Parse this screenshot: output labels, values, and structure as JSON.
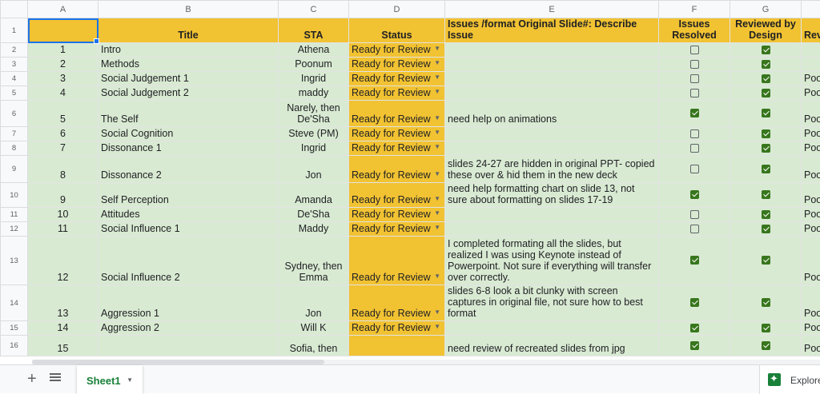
{
  "columns": [
    "A",
    "B",
    "C",
    "D",
    "E",
    "F",
    "G"
  ],
  "headers": {
    "a": "",
    "title": "Title",
    "sta": "STA",
    "status": "Status",
    "issues": "Issues /format Original Slide#: Describe Issue",
    "resolved": "Issues Resolved",
    "reviewed": "Reviewed by Design",
    "more": "Rev"
  },
  "rows": [
    {
      "rn": "2",
      "num": "1",
      "title": "Intro",
      "sta": "Athena",
      "status": "Ready for Review",
      "issue": "",
      "resolved": false,
      "reviewed": true,
      "more": ""
    },
    {
      "rn": "3",
      "num": "2",
      "title": "Methods",
      "sta": "Poonum",
      "status": "Ready for Review",
      "issue": "",
      "resolved": false,
      "reviewed": true,
      "more": ""
    },
    {
      "rn": "4",
      "num": "3",
      "title": "Social Judgement 1",
      "sta": "Ingrid",
      "status": "Ready for Review",
      "issue": "",
      "resolved": false,
      "reviewed": true,
      "more": "Poo"
    },
    {
      "rn": "5",
      "num": "4",
      "title": "Social Judgement 2",
      "sta": "maddy",
      "status": "Ready for Review",
      "issue": "",
      "resolved": false,
      "reviewed": true,
      "more": "Poo"
    },
    {
      "rn": "6",
      "num": "5",
      "title": "The Self",
      "sta": "Narely, then De'Sha",
      "status": "Ready for Review",
      "issue": "need help on animations",
      "resolved": true,
      "reviewed": true,
      "more": "Poo"
    },
    {
      "rn": "7",
      "num": "6",
      "title": "Social Cognition",
      "sta": "Steve (PM)",
      "status": "Ready for Review",
      "issue": "",
      "resolved": false,
      "reviewed": true,
      "more": "Poo"
    },
    {
      "rn": "8",
      "num": "7",
      "title": "Dissonance 1",
      "sta": "Ingrid",
      "status": "Ready for Review",
      "issue": "",
      "resolved": false,
      "reviewed": true,
      "more": "Poo"
    },
    {
      "rn": "9",
      "num": "8",
      "title": "Dissonance 2",
      "sta": "Jon",
      "status": "Ready for Review",
      "issue": "slides 24-27 are hidden in original PPT- copied these over & hid them in the new deck",
      "resolved": false,
      "reviewed": true,
      "more": "Poo"
    },
    {
      "rn": "10",
      "num": "9",
      "title": "Self Perception",
      "sta": "Amanda",
      "status": "Ready for Review",
      "issue": "need help formatting chart on slide 13, not sure about formatting on slides 17-19",
      "resolved": true,
      "reviewed": true,
      "more": "Poo"
    },
    {
      "rn": "11",
      "num": "10",
      "title": "Attitudes",
      "sta": "De'Sha",
      "status": "Ready for Review",
      "issue": "",
      "resolved": false,
      "reviewed": true,
      "more": "Poo"
    },
    {
      "rn": "12",
      "num": "11",
      "title": "Social Influence 1",
      "sta": "Maddy",
      "status": "Ready for Review",
      "issue": "",
      "resolved": false,
      "reviewed": true,
      "more": "Poo"
    },
    {
      "rn": "13",
      "num": "12",
      "title": "Social Influence 2",
      "sta": "Sydney, then Emma",
      "status": "Ready for Review",
      "issue": "I completed formating all the slides, but realized I was using Keynote instead of Powerpoint. Not sure if everything will transfer over correctly.",
      "resolved": true,
      "reviewed": true,
      "more": "Poo"
    },
    {
      "rn": "14",
      "num": "13",
      "title": "Aggression 1",
      "sta": "Jon",
      "status": "Ready for Review",
      "issue": "slides 6-8 look a bit clunky with screen captures in original file, not sure how to best format",
      "resolved": true,
      "reviewed": true,
      "more": "Poo"
    },
    {
      "rn": "15",
      "num": "14",
      "title": "Aggression 2",
      "sta": "Will K",
      "status": "Ready for Review",
      "issue": "",
      "resolved": true,
      "reviewed": true,
      "more": "Poo"
    },
    {
      "rn": "16",
      "num": "15",
      "title": "",
      "sta": "Sofia, then",
      "status": "",
      "issue": "need review of recreated slides from jpg",
      "resolved": true,
      "reviewed": true,
      "more": "Poo"
    }
  ],
  "tabs": {
    "sheet": "Sheet1",
    "explore": "Explore"
  },
  "colors": {
    "header_fill": "#f1c232",
    "row_fill": "#d9ead3",
    "check_fill": "#38761d",
    "accent": "#188038"
  }
}
